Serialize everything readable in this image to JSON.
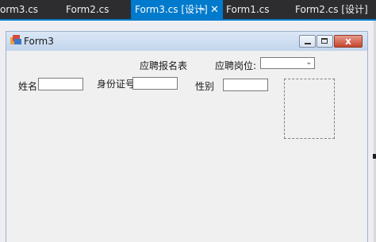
{
  "tabs": [
    {
      "label": "orm3.cs",
      "active": false
    },
    {
      "label": "Form2.cs",
      "active": false
    },
    {
      "label": "Form3.cs [设计]",
      "active": true,
      "pin_icon": "pin-icon",
      "close_glyph": "✕"
    },
    {
      "label": "Form1.cs",
      "active": false
    },
    {
      "label": "Form2.cs [设计]",
      "active": false
    }
  ],
  "form": {
    "title": "Form3",
    "icon": "form-icon",
    "close_glyph": "x"
  },
  "fields": {
    "form_heading": "应聘报名表",
    "position_label": "应聘岗位:",
    "position_value": "",
    "name_label": "姓名",
    "name_value": "",
    "id_label": "身份证号",
    "id_value": "",
    "gender_label": "性别",
    "gender_value": ""
  },
  "colors": {
    "ide_background": "#2d2d30",
    "active_tab": "#007acc",
    "form_background": "#f0f0f0",
    "titlebar": "#c3d5ec",
    "close_button": "#c5462e"
  }
}
